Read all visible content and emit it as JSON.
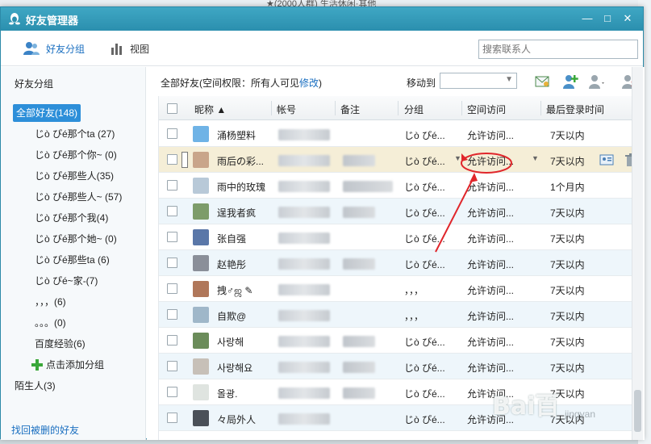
{
  "window": {
    "title": "好友管理器",
    "min_label": "—",
    "max_label": "□",
    "close_label": "✕"
  },
  "background": {
    "top_text": "★(2000人群) 生活休闲·其他"
  },
  "toolbar": {
    "friend_group_label": "好友分组",
    "view_label": "视图",
    "search_placeholder": "搜索联系人"
  },
  "sidebar": {
    "heading": "好友分组",
    "all_friends": "全部好友(148)",
    "groups": [
      "じò ぴé那个ta (27)",
      "じò ぴé那个你~ (0)",
      "じò ぴé那些人(35)",
      "じò ぴé那些人~ (57)",
      "じò ぴé那个我(4)",
      "じò ぴé那个她~ (0)",
      "じò ぴé那些ta (6)",
      "じò ぴé~家-(7)",
      "，，，(6)",
      "。。。(0)",
      "百度经验(6)"
    ],
    "add_group": "点击添加分组",
    "strangers": "陌生人(3)",
    "footer_link": "找回被删的好友"
  },
  "main": {
    "perm_text": "全部好友(空间权限：所有人可见",
    "perm_edit": "修改",
    "perm_close": ")",
    "move_to": "移动到"
  },
  "table": {
    "headers": {
      "nickname": "昵称",
      "account": "帐号",
      "remark": "备注",
      "group": "分组",
      "space": "空间访问",
      "last_login": "最后登录时间"
    },
    "rows": [
      {
        "nickname": "涌杨塑料",
        "group": "じò ぴé...",
        "space": "允许访问...",
        "last": "7天以内"
      },
      {
        "nickname": "雨后の彩...",
        "group": "じò ぴé...",
        "space": "允许访问...",
        "last": "7天以内"
      },
      {
        "nickname": "雨中的玫瑰",
        "group": "じò ぴé...",
        "space": "允许访问...",
        "last": "1个月内"
      },
      {
        "nickname": "逞我者疯",
        "group": "じò ぴé...",
        "space": "允许访问...",
        "last": "7天以内"
      },
      {
        "nickname": "张自强",
        "group": "じò ぴé...",
        "space": "允许访问...",
        "last": "7天以内"
      },
      {
        "nickname": "赵艳彤",
        "group": "じò ぴé...",
        "space": "允许访问...",
        "last": "7天以内"
      },
      {
        "nickname": "拽♂ஜ ✎",
        "group": "，，，",
        "space": "允许访问...",
        "last": "7天以内"
      },
      {
        "nickname": "自欺@",
        "group": "，，，",
        "space": "允许访问...",
        "last": "7天以内"
      },
      {
        "nickname": "사랑해",
        "group": "じò ぴé...",
        "space": "允许访问...",
        "last": "7天以内"
      },
      {
        "nickname": "사랑해요",
        "group": "じò ぴé...",
        "space": "允许访问...",
        "last": "7天以内"
      },
      {
        "nickname": "올광.",
        "group": "じò ぴé...",
        "space": "允许访问...",
        "last": "7天以内"
      },
      {
        "nickname": "々局外人",
        "group": "じò ぴé...",
        "space": "允许访问...",
        "last": "7天以内"
      }
    ]
  },
  "watermark": {
    "brand": "Bai",
    "brand_tail": "百",
    "sub": "jingyan"
  },
  "colors": {
    "titlebar": "#2b8fae",
    "accent": "#2d8fd9",
    "link": "#1a6fc0",
    "selected_row": "#f5eed7",
    "annotation": "#e0262b"
  }
}
